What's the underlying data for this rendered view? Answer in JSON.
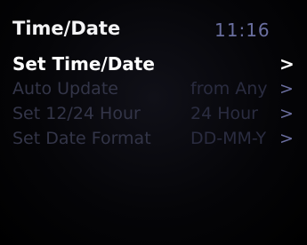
{
  "header": {
    "title": "Time/Date",
    "time": "11:16"
  },
  "menu": {
    "items": [
      {
        "label": "Set Time/Date",
        "value": "",
        "chevron": ">"
      },
      {
        "label": "Auto Update",
        "value": "from Any",
        "chevron": ">"
      },
      {
        "label": "Set 12/24 Hour",
        "value": "24 Hour",
        "chevron": ">"
      },
      {
        "label": "Set Date Format",
        "value": "DD-MM-Y",
        "chevron": ">"
      }
    ]
  },
  "colors": {
    "background": "#000000",
    "title": "#f4f4f6",
    "time": "#6a6fa0",
    "selected_text": "#ffffff",
    "disabled_text": "#333548",
    "disabled_chevron": "#6b6fa0"
  }
}
